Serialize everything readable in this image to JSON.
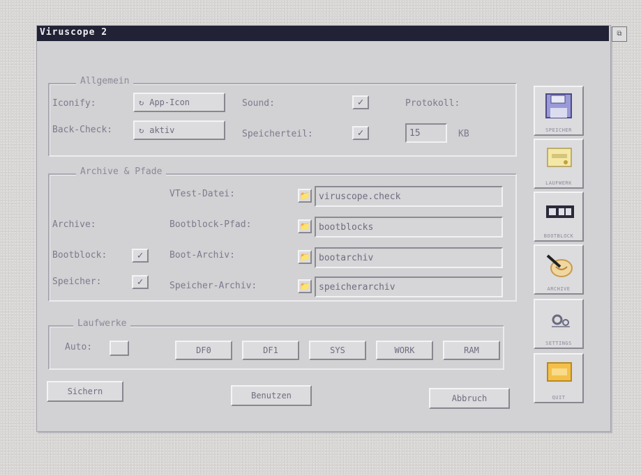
{
  "window": {
    "title": "Viruscope 2"
  },
  "allgemein": {
    "title": "Allgemein",
    "iconify_label": "Iconify:",
    "iconify_value": "App-Icon",
    "backcheck_label": "Back-Check:",
    "backcheck_value": "aktiv",
    "sound_label": "Sound:",
    "sound_checked": "✓",
    "speicherteil_label": "Speicherteil:",
    "speicherteil_checked": "✓",
    "protokoll_label": "Protokoll:",
    "protokoll_value": "15",
    "protokoll_unit": "KB"
  },
  "archive": {
    "title": "Archive & Pfade",
    "vtest_label": "VTest-Datei:",
    "vtest_value": "viruscope.check",
    "archive_label": "Archive:",
    "bootblock_pfad_label": "Bootblock-Pfad:",
    "bootblock_pfad_value": "bootblocks",
    "bootblock_label": "Bootblock:",
    "bootblock_checked": "✓",
    "boot_archiv_label": "Boot-Archiv:",
    "boot_archiv_value": "bootarchiv",
    "speicher_label": "Speicher:",
    "speicher_checked": "✓",
    "speicher_archiv_label": "Speicher-Archiv:",
    "speicher_archiv_value": "speicherarchiv"
  },
  "laufwerke": {
    "title": "Laufwerke",
    "auto_label": "Auto:",
    "drives": [
      "DF0",
      "DF1",
      "SYS",
      "WORK",
      "RAM"
    ]
  },
  "buttons": {
    "save": "Sichern",
    "use": "Benutzen",
    "cancel": "Abbruch"
  },
  "sidebar": {
    "items": [
      {
        "label": "SPEICHER",
        "icon": "disk-icon"
      },
      {
        "label": "LAUFWERK",
        "icon": "drive-icon"
      },
      {
        "label": "BOOTBLOCK",
        "icon": "bootblock-icon"
      },
      {
        "label": "ARCHIVE",
        "icon": "archive-icon"
      },
      {
        "label": "SETTINGS",
        "icon": "settings-icon"
      },
      {
        "label": "QUIT",
        "icon": "quit-icon"
      }
    ]
  },
  "colors": {
    "titlebar": "#222236",
    "window": "#d2d1d3"
  }
}
